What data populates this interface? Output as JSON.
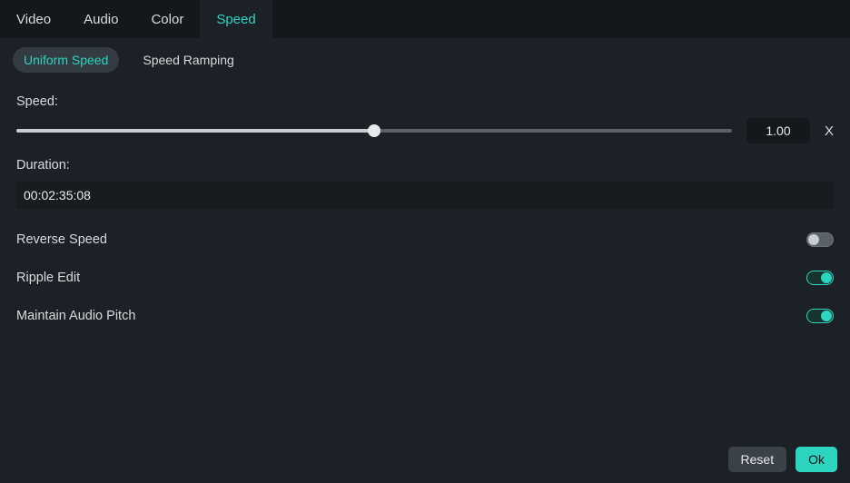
{
  "tabs": {
    "video": "Video",
    "audio": "Audio",
    "color": "Color",
    "speed": "Speed"
  },
  "subtabs": {
    "uniform": "Uniform Speed",
    "ramping": "Speed Ramping"
  },
  "speed": {
    "label": "Speed:",
    "value": "1.00",
    "suffix": "X",
    "slider_percent": 50
  },
  "duration": {
    "label": "Duration:",
    "value": "00:02:35:08"
  },
  "toggles": {
    "reverse": {
      "label": "Reverse Speed",
      "on": false
    },
    "ripple": {
      "label": "Ripple Edit",
      "on": true
    },
    "pitch": {
      "label": "Maintain Audio Pitch",
      "on": true
    }
  },
  "buttons": {
    "reset": "Reset",
    "ok": "Ok"
  }
}
